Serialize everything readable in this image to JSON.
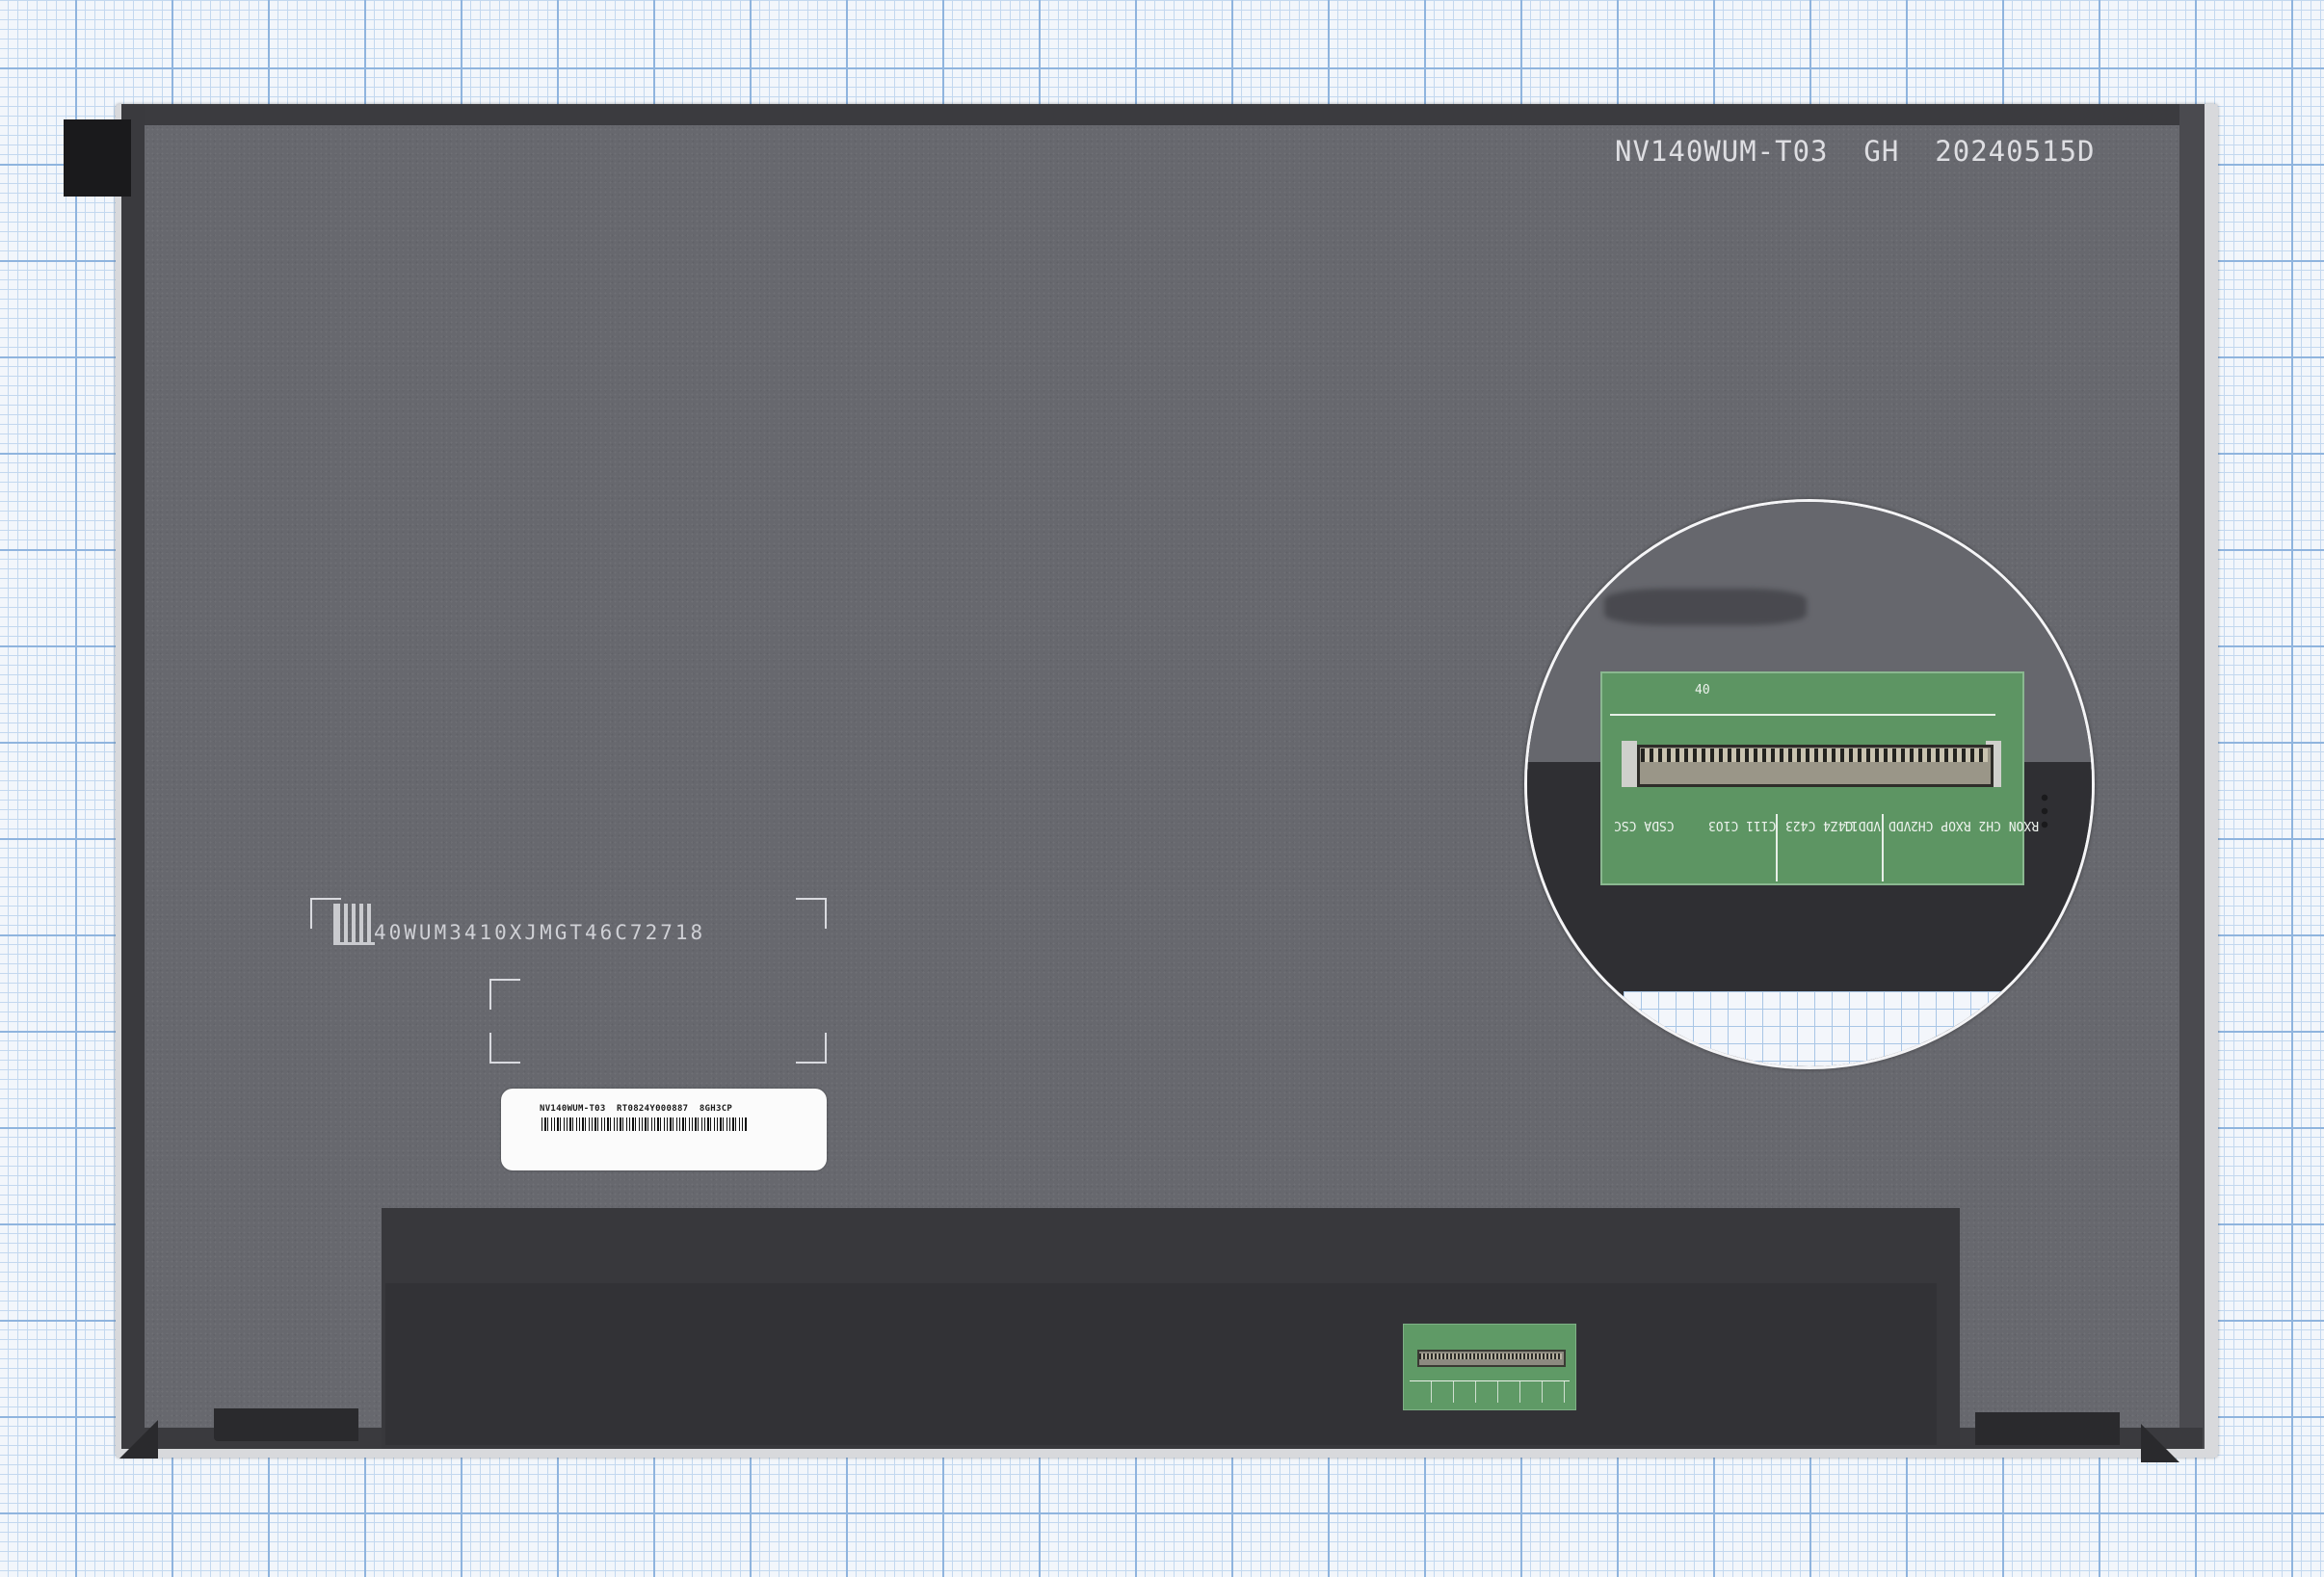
{
  "photo": {
    "subject": "laptop-lcd-panel-back",
    "background": "graph-paper",
    "colors": {
      "panel_back": "#67686e",
      "pcb_green": "#5d9563",
      "grid_blue": "#8fb4de"
    }
  },
  "panel": {
    "model_print": "NV140WUM-T03  GH  20240515D",
    "serial_marking": "40WUM3410XJMGT46C72718"
  },
  "label": {
    "text": "NV140WUM-T03  RT0824Y000887  8GH3CP"
  },
  "inset": {
    "silkscreen": [
      "CSDA CSC",
      "C111 C1O3",
      "C4Z4 C423",
      "VDD VDD11",
      "RXON CH2 RXOP CH2",
      "40"
    ]
  }
}
